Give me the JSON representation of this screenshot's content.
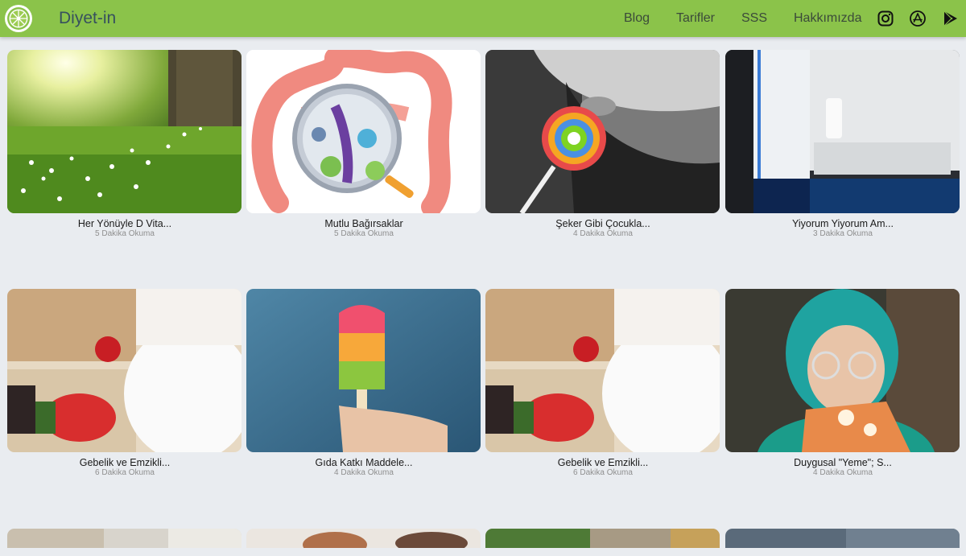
{
  "header": {
    "brand": "Diyet-in",
    "logo_icon": "lime-slice-icon",
    "nav": [
      "Blog",
      "Tarifler",
      "SSS",
      "Hakkımızda"
    ],
    "social_icons": [
      "instagram-icon",
      "app-store-icon",
      "google-play-icon"
    ],
    "bar_color": "#8bc34a"
  },
  "articles": [
    {
      "title": "Her Yönüyle D Vita...",
      "read_time": "5 Dakika Okuma",
      "image": "sunlit-meadow-image"
    },
    {
      "title": "Mutlu Bağırsaklar",
      "read_time": "5 Dakika Okuma",
      "image": "gut-bacteria-illustration"
    },
    {
      "title": "Şeker Gibi Çocukla...",
      "read_time": "4 Dakika Okuma",
      "image": "child-lollipop-image"
    },
    {
      "title": "Yiyorum Yiyorum Am...",
      "read_time": "3 Dakika Okuma",
      "image": "open-fridge-image"
    },
    {
      "title": "Gebelik ve Emzikli...",
      "read_time": "6 Dakika Okuma",
      "image": "pregnant-apple-image"
    },
    {
      "title": "Gıda Katkı Maddele...",
      "read_time": "4 Dakika Okuma",
      "image": "popsicle-image"
    },
    {
      "title": "Gebelik ve Emzikli...",
      "read_time": "6 Dakika Okuma",
      "image": "pregnant-apple-image"
    },
    {
      "title": "Duygusal \"Yeme\"; S...",
      "read_time": "4 Dakika Okuma",
      "image": "teal-hair-pizza-image"
    }
  ]
}
